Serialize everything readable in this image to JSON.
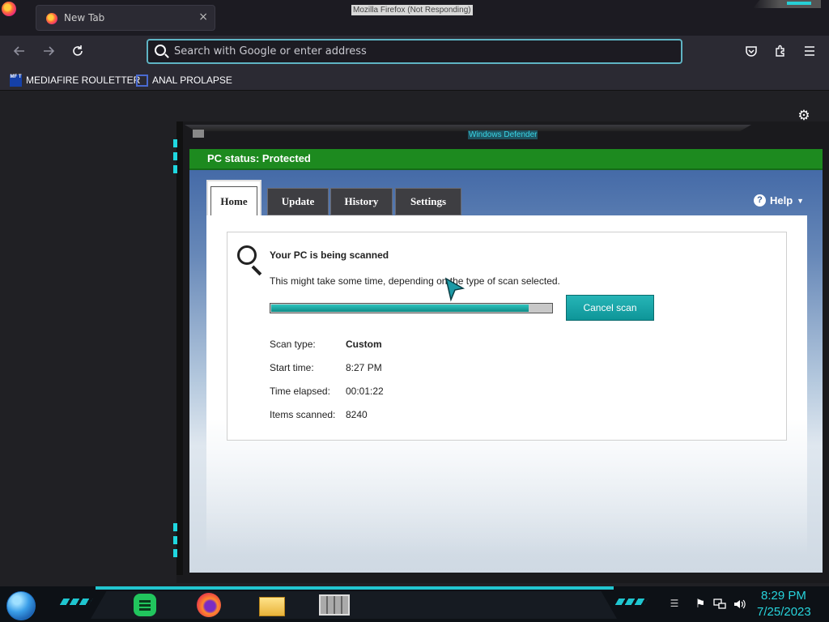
{
  "browser": {
    "window_title": "Mozilla Firefox (Not Responding)",
    "tab": {
      "title": "New Tab",
      "close": "×"
    },
    "urlbar": {
      "placeholder": "Search with Google or enter address"
    },
    "nav": {
      "back_icon": "arrow-left-icon",
      "forward_icon": "arrow-right-icon",
      "reload_icon": "reload-icon"
    },
    "toolbar_icons": [
      "pocket-icon",
      "extensions-icon",
      "menu-icon"
    ],
    "bookmarks": [
      {
        "label": "MEDIAFIRE ROULETTER",
        "icon_text": "MF T"
      },
      {
        "label": "ANAL PROLAPSE"
      }
    ]
  },
  "defender": {
    "window_title": "Windows Defender",
    "status": "PC status: Protected",
    "tabs": [
      {
        "label": "Home",
        "active": true
      },
      {
        "label": "Update",
        "active": false
      },
      {
        "label": "History",
        "active": false
      },
      {
        "label": "Settings",
        "active": false
      }
    ],
    "help": {
      "label": "Help",
      "chevron": "▼"
    },
    "scan": {
      "title": "Your PC is being scanned",
      "description": "This might take some time, depending on the type of scan selected.",
      "progress": 0.92,
      "cancel_label": "Cancel scan",
      "details": [
        {
          "label": "Scan type:",
          "value": "Custom",
          "bold": true
        },
        {
          "label": "Start time:",
          "value": "8:27 PM"
        },
        {
          "label": "Time elapsed:",
          "value": "00:01:22"
        },
        {
          "label": "Items scanned:",
          "value": "8240"
        }
      ]
    },
    "colors": {
      "status_green": "#1d8a1f",
      "accent_teal": "#0e9598"
    }
  },
  "taskbar": {
    "apps": [
      "notes-app-icon",
      "firefox-icon",
      "file-explorer-icon",
      "windows-defender-icon"
    ],
    "clock": {
      "time": "8:29 PM",
      "date": "7/25/2023"
    }
  }
}
